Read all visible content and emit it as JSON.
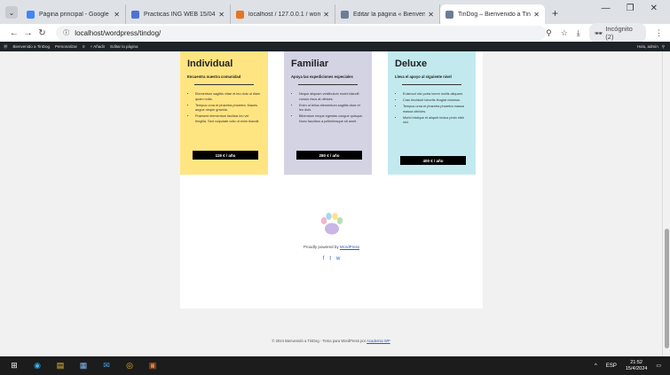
{
  "browser": {
    "tabs": [
      {
        "title": "Página principal - Google D",
        "color": "#4285f4"
      },
      {
        "title": "Practicas ING WEB 15/04 - G",
        "color": "#4e72d6"
      },
      {
        "title": "localhost / 127.0.0.1 / wordp",
        "color": "#e8741f"
      },
      {
        "title": "Editar la página « Bienvenid",
        "color": "#6b7e95"
      },
      {
        "title": "TinDog – Bienvenido a TinD",
        "color": "#6b7e95"
      }
    ],
    "new_tab": "+",
    "url": "localhost/wordpress/tindog/",
    "incognito_label": "Incógnito (2)"
  },
  "wpbar": {
    "items": [
      "Bienvenido a TinDog",
      "Personalizar",
      "0",
      "+ Añadir",
      "Editar la página"
    ],
    "right": "Hola, admin"
  },
  "plans": [
    {
      "name": "Individual",
      "subtitle": "Encuentra nuestra comunidad",
      "color": "#ffe582",
      "bullets": [
        "Elementum sagittis vitae et leo duis ut diam quam nulla.",
        "Tempus urna et pharetra pharetra. Mauris augue neque gravida.",
        "Praesent elementum facilisis leo vel fringilla. Sed vulputate odio ut enim blandit."
      ],
      "price": "119 € / año"
    },
    {
      "name": "Familiar",
      "subtitle": "Apoya las expediciones especiales",
      "color": "#d3d3e4",
      "bullets": [
        "Neque aliquam vestibulum morbi blandit cursus risus at ultrices.",
        "Enim ut tellus elementum sagittis vitae et leo duis.",
        "Bibendum neque egestas congue quisque. Nunc faucibus a pellentesque sit amet."
      ],
      "price": "280 € / año"
    },
    {
      "name": "Deluxe",
      "subtitle": "Lleva el apoyo al siguiente nivel",
      "color": "#c2eaee",
      "bullets": [
        "Euismod nisi porta lorem mollis aliquam.",
        "Cras tincidunt lobortis feugiat vivamus.",
        "Tempus urna et pharetra pharetra massa massa ultricies.",
        "Morbi tristique et aliquet lectus proin nibh nisl."
      ],
      "price": "400 € / año"
    }
  ],
  "footer": {
    "powered_prefix": "Proudly powered by",
    "powered_link": "WordPress",
    "social": [
      "f",
      "t",
      "w"
    ],
    "copyright_prefix": "© 2024 Bienvenido a TinDog - Tema para WordPress por",
    "copyright_link": "Academia WP"
  },
  "taskbar": {
    "lang": "ESP",
    "time": "21:52",
    "date": "15/4/2024"
  }
}
